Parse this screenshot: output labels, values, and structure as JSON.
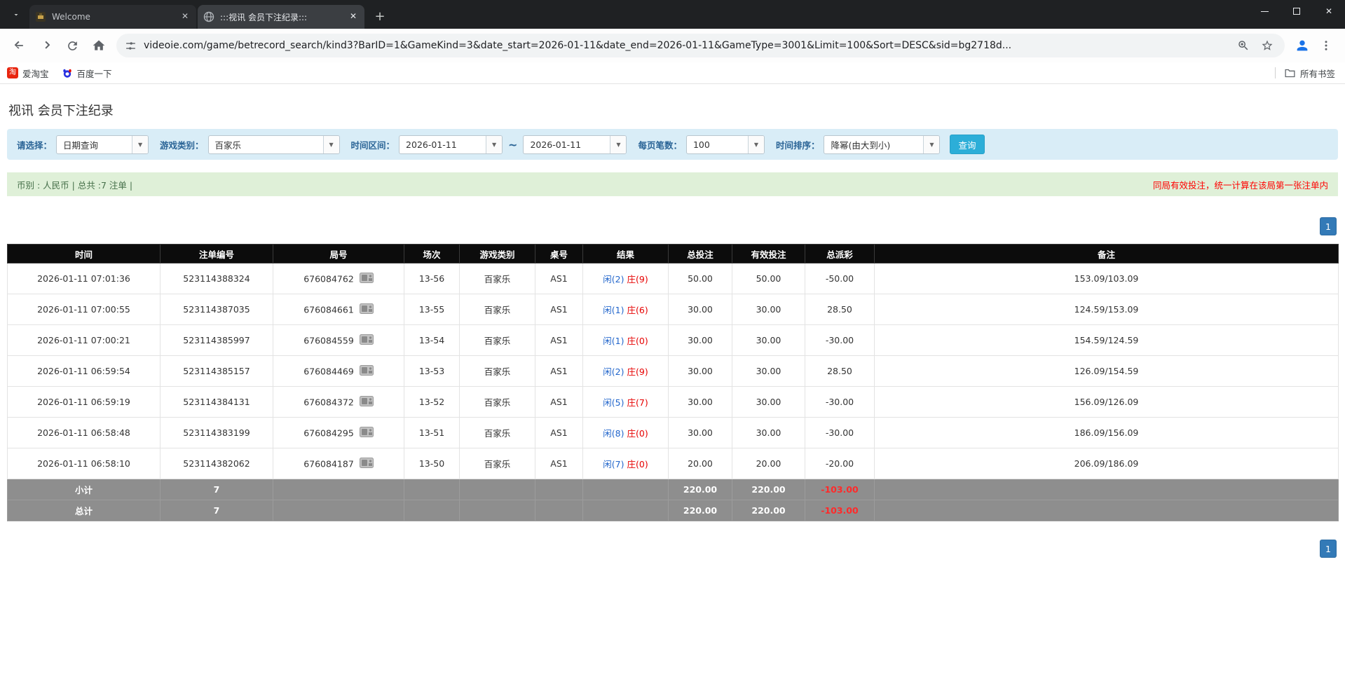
{
  "browser": {
    "tabs": [
      {
        "title": "Welcome"
      },
      {
        "title": ":::视讯 会员下注纪录:::"
      }
    ],
    "url": "videoie.com/game/betrecord_search/kind3?BarID=1&GameKind=3&date_start=2026-01-11&date_end=2026-01-11&GameType=3001&Limit=100&Sort=DESC&sid=bg2718d...",
    "bookmarks": [
      {
        "label": "爱淘宝",
        "icon": "taobao-icon"
      },
      {
        "label": "百度一下",
        "icon": "baidu-icon"
      }
    ],
    "bookmarks_right": "所有书签",
    "icons": {
      "new_tab": "+",
      "close": "✕",
      "tab_search": "⌄"
    }
  },
  "page": {
    "title": "视讯 会员下注纪录",
    "filters": {
      "select_label": "请选择：",
      "select_value": "日期查询",
      "game_label": "游戏类别：",
      "game_value": "百家乐",
      "range_label": "时间区间：",
      "date_start": "2026-01-11",
      "tilde": "~",
      "date_end": "2026-01-11",
      "limit_label": "每页笔数：",
      "limit_value": "100",
      "sort_label": "时间排序：",
      "sort_value": "降幂(由大到小)",
      "search_button": "查询"
    },
    "summary": {
      "left": "币别 : 人民币 | 总共 :7 注单 |",
      "right": "同局有效投注，统一计算在该局第一张注单内"
    },
    "pagination": "1",
    "table": {
      "headers": [
        "时间",
        "注单编号",
        "局号",
        "场次",
        "游戏类别",
        "桌号",
        "结果",
        "总投注",
        "有效投注",
        "总派彩",
        "备注"
      ],
      "rows": [
        {
          "time": "2026-01-11 07:01:36",
          "bet_id": "523114388324",
          "round": "676084762",
          "session": "13-56",
          "game": "百家乐",
          "table": "AS1",
          "result_player": "闲(2)",
          "result_banker": "庄(9)",
          "total_bet": "50.00",
          "valid_bet": "50.00",
          "payout": "-50.00",
          "note": "153.09/103.09"
        },
        {
          "time": "2026-01-11 07:00:55",
          "bet_id": "523114387035",
          "round": "676084661",
          "session": "13-55",
          "game": "百家乐",
          "table": "AS1",
          "result_player": "闲(1)",
          "result_banker": "庄(6)",
          "total_bet": "30.00",
          "valid_bet": "30.00",
          "payout": "28.50",
          "note": "124.59/153.09"
        },
        {
          "time": "2026-01-11 07:00:21",
          "bet_id": "523114385997",
          "round": "676084559",
          "session": "13-54",
          "game": "百家乐",
          "table": "AS1",
          "result_player": "闲(1)",
          "result_banker": "庄(0)",
          "total_bet": "30.00",
          "valid_bet": "30.00",
          "payout": "-30.00",
          "note": "154.59/124.59"
        },
        {
          "time": "2026-01-11 06:59:54",
          "bet_id": "523114385157",
          "round": "676084469",
          "session": "13-53",
          "game": "百家乐",
          "table": "AS1",
          "result_player": "闲(2)",
          "result_banker": "庄(9)",
          "total_bet": "30.00",
          "valid_bet": "30.00",
          "payout": "28.50",
          "note": "126.09/154.59"
        },
        {
          "time": "2026-01-11 06:59:19",
          "bet_id": "523114384131",
          "round": "676084372",
          "session": "13-52",
          "game": "百家乐",
          "table": "AS1",
          "result_player": "闲(5)",
          "result_banker": "庄(7)",
          "total_bet": "30.00",
          "valid_bet": "30.00",
          "payout": "-30.00",
          "note": "156.09/126.09"
        },
        {
          "time": "2026-01-11 06:58:48",
          "bet_id": "523114383199",
          "round": "676084295",
          "session": "13-51",
          "game": "百家乐",
          "table": "AS1",
          "result_player": "闲(8)",
          "result_banker": "庄(0)",
          "total_bet": "30.00",
          "valid_bet": "30.00",
          "payout": "-30.00",
          "note": "186.09/156.09"
        },
        {
          "time": "2026-01-11 06:58:10",
          "bet_id": "523114382062",
          "round": "676084187",
          "session": "13-50",
          "game": "百家乐",
          "table": "AS1",
          "result_player": "闲(7)",
          "result_banker": "庄(0)",
          "total_bet": "20.00",
          "valid_bet": "20.00",
          "payout": "-20.00",
          "note": "206.09/186.09"
        }
      ],
      "subtotal": {
        "label": "小计",
        "count": "7",
        "total_bet": "220.00",
        "valid_bet": "220.00",
        "payout": "-103.00"
      },
      "total": {
        "label": "总计",
        "count": "7",
        "total_bet": "220.00",
        "valid_bet": "220.00",
        "payout": "-103.00"
      }
    }
  }
}
